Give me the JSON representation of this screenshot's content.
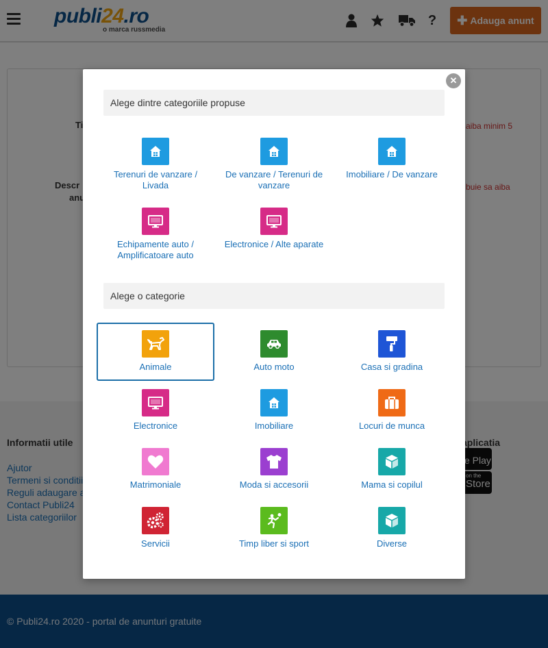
{
  "header": {
    "logo_main": "publi",
    "logo_num": "24",
    "logo_tld": ".ro",
    "logo_sub": "o marca russmedia",
    "add_button": "Adauga anunt"
  },
  "form": {
    "label_title_partial": "Ti",
    "label_desc_partial_1": "Descr",
    "label_desc_partial_2": "anu",
    "error_title_partial": "aiba minim 5",
    "error_desc_partial": "buie sa aiba"
  },
  "footer": {
    "info_title": "Informatii utile",
    "links": [
      "Ajutor",
      "Termeni si conditii",
      "Reguli adaugare a",
      "Contact Publi24",
      "Lista categoriilor"
    ],
    "app_title": "aplicatia",
    "store_1": "e Play",
    "store_2_small": "on the",
    "store_2": "Store",
    "copyright": "© Publi24.ro 2020 - portal de anunturi gratuite"
  },
  "modal": {
    "section_suggested": "Alege dintre categoriile propuse",
    "section_all": "Alege o categorie",
    "suggested": [
      {
        "label1": "Terenuri de vanzare /",
        "label2": "Livada",
        "icon": "house-icon",
        "color": "#1e9be0"
      },
      {
        "label1": "De vanzare / Terenuri de",
        "label2": "vanzare",
        "icon": "house-icon",
        "color": "#1e9be0"
      },
      {
        "label1": "Imobiliare / De vanzare",
        "label2": "",
        "icon": "house-icon",
        "color": "#1e9be0"
      },
      {
        "label1": "Echipamente auto /",
        "label2": "Amplificatoare auto",
        "icon": "monitor-icon",
        "color": "#d62b87"
      },
      {
        "label1": "Electronice / Alte aparate",
        "label2": "",
        "icon": "monitor-icon",
        "color": "#d62b87"
      }
    ],
    "categories": [
      {
        "label": "Animale",
        "icon": "dog-icon",
        "color": "#f2a20c"
      },
      {
        "label": "Auto moto",
        "icon": "car-icon",
        "color": "#2e8b2e"
      },
      {
        "label": "Casa si gradina",
        "icon": "paint-roller-icon",
        "color": "#1e55d6"
      },
      {
        "label": "Electronice",
        "icon": "monitor-icon",
        "color": "#d62b87"
      },
      {
        "label": "Imobiliare",
        "icon": "house-icon",
        "color": "#1e9be0"
      },
      {
        "label": "Locuri de munca",
        "icon": "briefcase-icon",
        "color": "#ef6a16"
      },
      {
        "label": "Matrimoniale",
        "icon": "heart-icon",
        "color": "#f07ad0"
      },
      {
        "label": "Moda si accesorii",
        "icon": "tshirt-icon",
        "color": "#9b3fd0"
      },
      {
        "label": "Mama si copilul",
        "icon": "box-icon",
        "color": "#17a8a8"
      },
      {
        "label": "Servicii",
        "icon": "gears-icon",
        "color": "#d02434"
      },
      {
        "label": "Timp liber si sport",
        "icon": "sport-icon",
        "color": "#5bbb1e"
      },
      {
        "label": "Diverse",
        "icon": "box-icon",
        "color": "#17a8a8"
      }
    ],
    "selected_category": "Animale"
  }
}
